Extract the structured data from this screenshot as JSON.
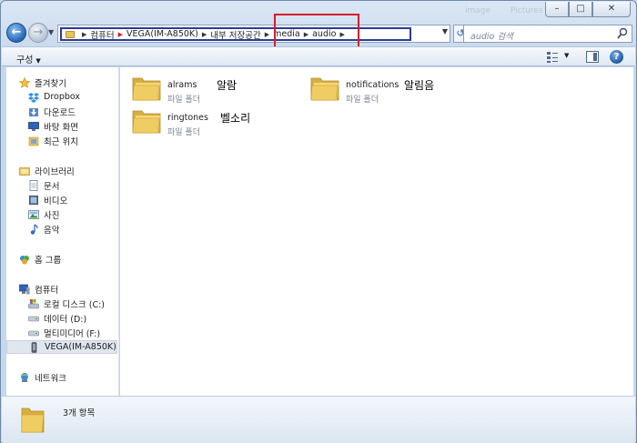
{
  "window": {
    "caption": {
      "minimize": "–",
      "maximize": "□",
      "close": "✕"
    },
    "ghost_left": "image",
    "ghost_right": "Pictures"
  },
  "nav": {
    "back": "←",
    "forward": "→",
    "history": "▼",
    "refresh": "↺"
  },
  "address": {
    "crumbs": [
      "컴퓨터",
      "VEGA(IM-A850K)",
      "내부 저장공간",
      "media",
      "audio"
    ],
    "dropdown": "▼"
  },
  "search": {
    "placeholder": "audio 검색"
  },
  "toolbar": {
    "organize_label": "구성",
    "organize_arrow": "▼",
    "view_arrow": "▼",
    "help": "?"
  },
  "sidebar": {
    "favorites": {
      "label": "즐겨찾기",
      "items": [
        "Dropbox",
        "다운로드",
        "바탕 화면",
        "최근 위치"
      ]
    },
    "libraries": {
      "label": "라이브러리",
      "items": [
        "문서",
        "비디오",
        "사진",
        "음악"
      ]
    },
    "homegroup": {
      "label": "홈 그룹"
    },
    "computer": {
      "label": "컴퓨터",
      "items": [
        "로컬 디스크 (C:)",
        "데이터 (D:)",
        "멀티미디어 (F:)",
        "VEGA(IM-A850K)"
      ]
    },
    "network": {
      "label": "네트워크"
    }
  },
  "items": [
    {
      "name": "alrams",
      "type": "파일 폴더",
      "note": "알람"
    },
    {
      "name": "notifications",
      "type": "파일 폴더",
      "note": "알림음"
    },
    {
      "name": "ringtones",
      "type": "파일 폴더",
      "note": "벨소리"
    }
  ],
  "status": {
    "count": "3개 항목"
  },
  "colors": {
    "highlight_red": "#d41e2a",
    "address_blue": "#2a3c96",
    "folder": "#e8c45c"
  }
}
